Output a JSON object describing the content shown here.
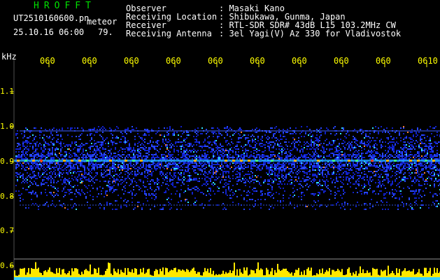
{
  "header": {
    "title": "HROFFT",
    "filename": "UT2510160600.pn",
    "filename_suffix": "meteor",
    "datetime": "25.10.16 06:00",
    "count": "79."
  },
  "info": [
    {
      "label": "Observer",
      "value": ": Masaki Kano"
    },
    {
      "label": "Receiving Location",
      "value": ": Shibukawa, Gunma, Japan"
    },
    {
      "label": "Receiver",
      "value": ": RTL-SDR SDR# 43dB L15 103.2MHz CW"
    },
    {
      "label": "Receiving Antenna",
      "value": ": 3el Yagi(V) Az 330 for Vladivostok"
    }
  ],
  "axes": {
    "y_unit": "kHz",
    "y_ticks": [
      "1.1",
      "1.0",
      "0.9",
      "0.8",
      "0.7",
      "0.6"
    ],
    "x_ticks": [
      "060",
      "060",
      "060",
      "060",
      "060",
      "060",
      "060",
      "060",
      "060",
      "0610"
    ]
  },
  "colors": {
    "title": "#00e000",
    "text": "#ffffff",
    "axis_label": "#ffff00",
    "grid": "#505050",
    "signal": "#2038ff",
    "baseline": "#3ad0ff",
    "level": "#ffe800"
  }
}
